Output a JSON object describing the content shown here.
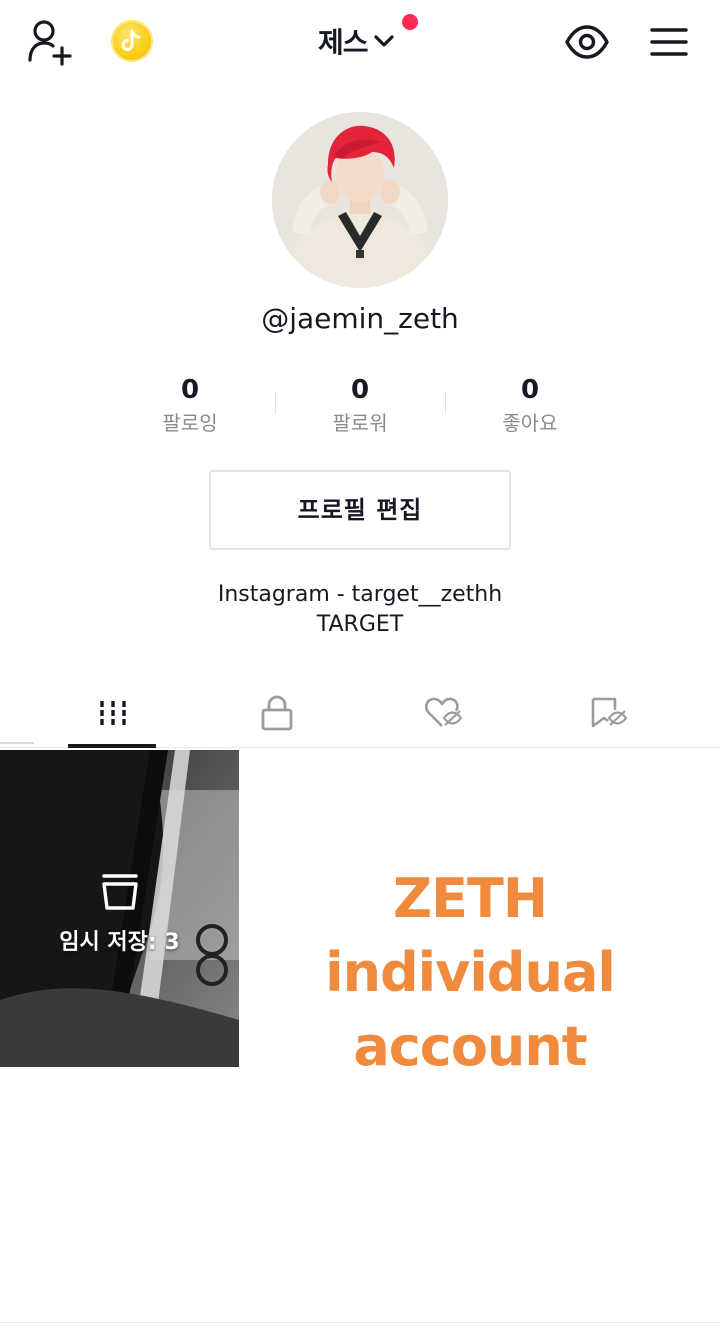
{
  "header": {
    "account_name": "제스",
    "icons": {
      "add_friend": "person-add-icon",
      "coin": "tiktok-coin-icon",
      "dropdown": "chevron-down-icon",
      "view": "eye-icon",
      "menu": "hamburger-menu-icon"
    }
  },
  "profile": {
    "username": "@jaemin_zeth",
    "stats": [
      {
        "value": "0",
        "label": "팔로잉"
      },
      {
        "value": "0",
        "label": "팔로워"
      },
      {
        "value": "0",
        "label": "좋아요"
      }
    ],
    "edit_button": "프로필 편집",
    "bio_line1": "Instagram - target__zethh",
    "bio_line2": "TARGET"
  },
  "tabs": [
    {
      "icon": "grid-icon",
      "active": true
    },
    {
      "icon": "lock-icon",
      "active": false
    },
    {
      "icon": "liked-hidden-icon",
      "active": false
    },
    {
      "icon": "bookmark-hidden-icon",
      "active": false
    }
  ],
  "content": {
    "drafts_label": "임시 저장: 3",
    "overlay_line1": "ZETH individual",
    "overlay_line2": "account"
  },
  "colors": {
    "accent_red": "#fe2c55",
    "coin_yellow": "#f8cf1a",
    "overlay_orange": "#f08a3c"
  }
}
